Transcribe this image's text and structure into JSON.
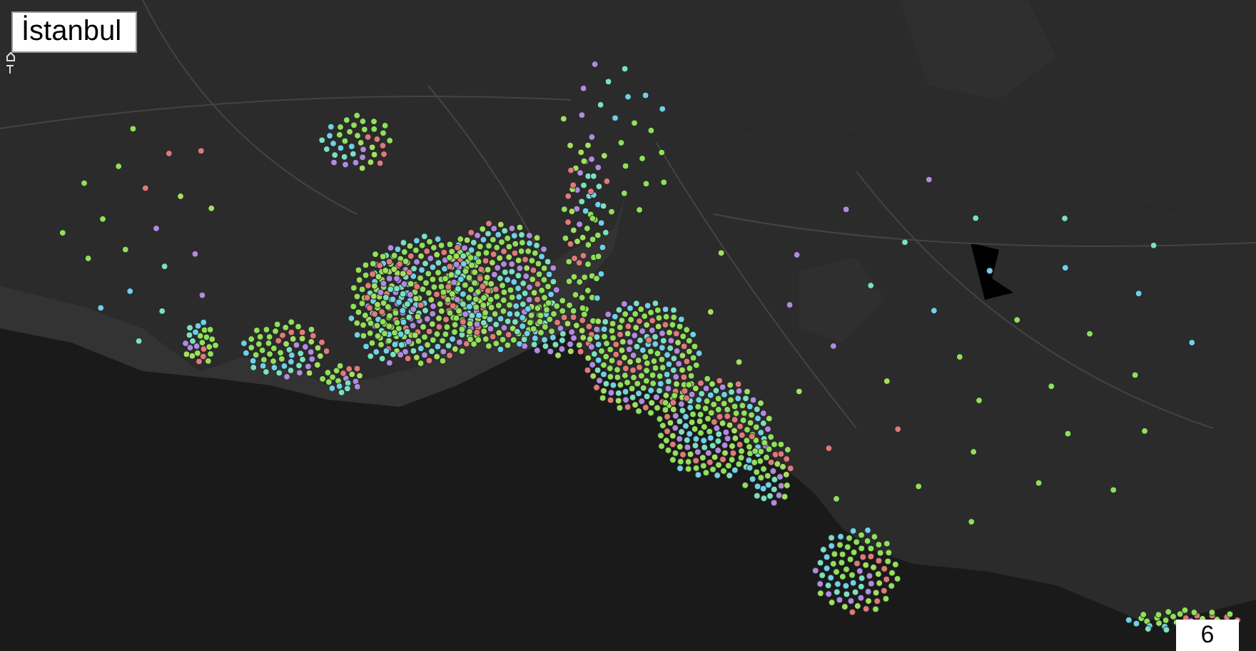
{
  "title": "İstanbul",
  "page_number": "6"
}
